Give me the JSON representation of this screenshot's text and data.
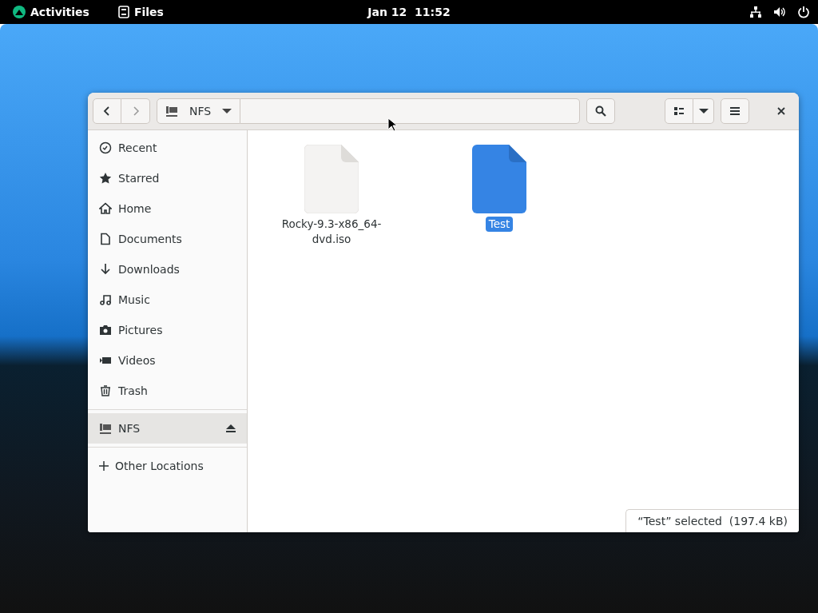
{
  "top_bar": {
    "activities": "Activities",
    "app_menu": "Files",
    "clock": "Jan 12  11:52"
  },
  "window": {
    "location": "NFS",
    "sidebar": {
      "items": [
        {
          "label": "Recent",
          "selected": false
        },
        {
          "label": "Starred",
          "selected": false
        },
        {
          "label": "Home",
          "selected": false
        },
        {
          "label": "Documents",
          "selected": false
        },
        {
          "label": "Downloads",
          "selected": false
        },
        {
          "label": "Music",
          "selected": false
        },
        {
          "label": "Pictures",
          "selected": false
        },
        {
          "label": "Videos",
          "selected": false
        },
        {
          "label": "Trash",
          "selected": false
        }
      ],
      "mounts": [
        {
          "label": "NFS",
          "selected": true
        }
      ],
      "other": "Other Locations"
    },
    "files": [
      {
        "name": "Rocky-9.3-x86_64-dvd.iso",
        "selected": false
      },
      {
        "name": "Test",
        "selected": true
      }
    ],
    "status": "“Test” selected  (197.4 kB)"
  }
}
